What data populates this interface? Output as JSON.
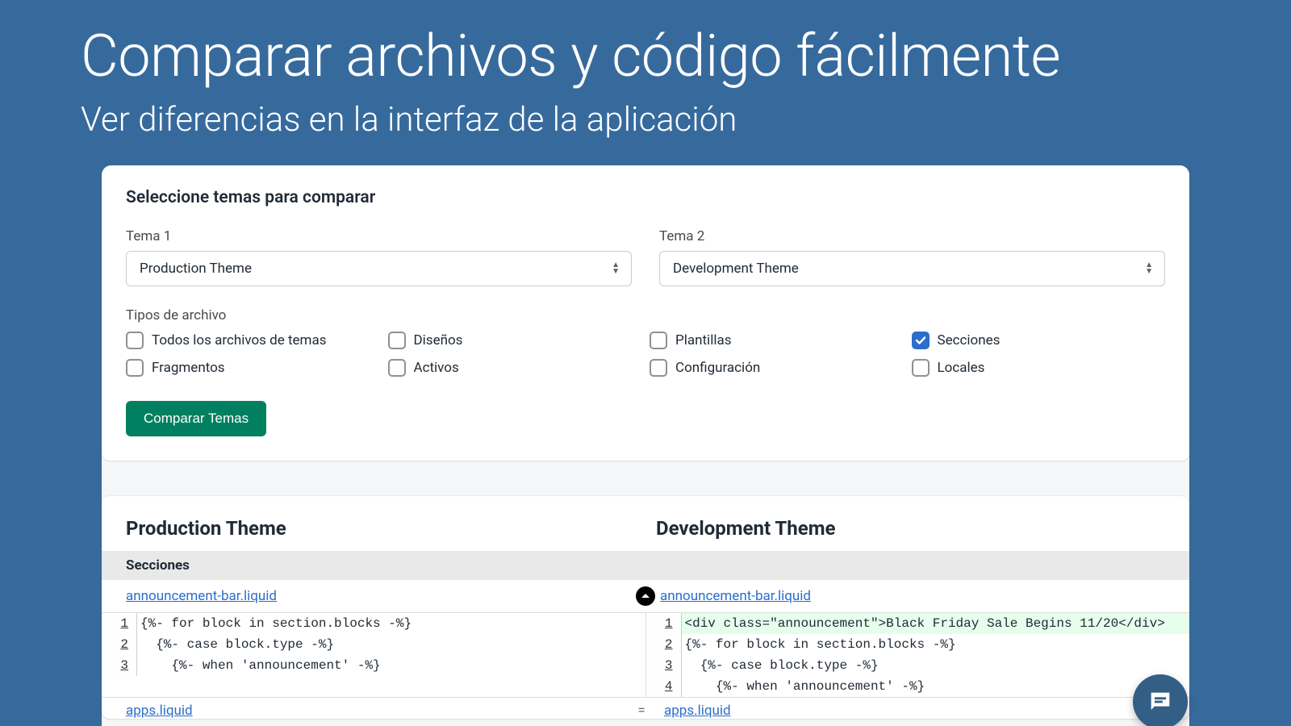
{
  "hero": {
    "title": "Comparar archivos y código fácilmente",
    "subtitle": "Ver diferencias en la interfaz de la aplicación"
  },
  "selector": {
    "heading": "Seleccione temas para comparar",
    "theme1_label": "Tema 1",
    "theme1_value": "Production Theme",
    "theme2_label": "Tema 2",
    "theme2_value": "Development Theme",
    "filetypes_label": "Tipos de archivo",
    "checkboxes": [
      {
        "label": "Todos los archivos de temas",
        "checked": false
      },
      {
        "label": "Diseños",
        "checked": false
      },
      {
        "label": "Plantillas",
        "checked": false
      },
      {
        "label": "Secciones",
        "checked": true
      },
      {
        "label": "Fragmentos",
        "checked": false
      },
      {
        "label": "Activos",
        "checked": false
      },
      {
        "label": "Configuración",
        "checked": false
      },
      {
        "label": "Locales",
        "checked": false
      }
    ],
    "compare_button": "Comparar Temas"
  },
  "results": {
    "left_title": "Production Theme",
    "right_title": "Development Theme",
    "section_name": "Secciones",
    "file_left": "announcement-bar.liquid",
    "file_right": "announcement-bar.liquid",
    "left_code": [
      {
        "n": "",
        "t": "",
        "blank": true
      },
      {
        "n": "1",
        "t": "{%- for block in section.blocks -%}"
      },
      {
        "n": "2",
        "t": "  {%- case block.type -%}"
      },
      {
        "n": "3",
        "t": "    {%- when 'announcement' -%}"
      }
    ],
    "right_code": [
      {
        "n": "1",
        "t": "<div class=\"announcement\">Black Friday Sale Begins 11/20</div>",
        "added": true
      },
      {
        "n": "2",
        "t": "{%- for block in section.blocks -%}"
      },
      {
        "n": "3",
        "t": "  {%- case block.type -%}"
      },
      {
        "n": "4",
        "t": "    {%- when 'announcement' -%}"
      }
    ],
    "next_file_left": "apps.liquid",
    "next_file_right": "apps.liquid",
    "equal_symbol": "="
  }
}
